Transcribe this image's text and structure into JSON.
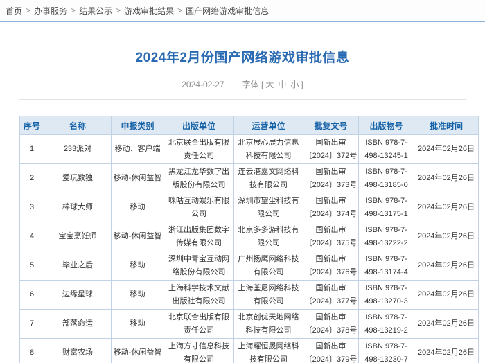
{
  "breadcrumb": {
    "separator": ">",
    "items": [
      "首页",
      "办事服务",
      "结果公示",
      "游戏审批结果",
      "国产网络游戏审批信息"
    ]
  },
  "article": {
    "title": "2024年2月份国产网络游戏审批信息",
    "date": "2024-02-27",
    "font_size_label": "字体",
    "bracket_open": "[",
    "bracket_close": "]",
    "font_size_options": [
      "大",
      "中",
      "小"
    ]
  },
  "table": {
    "columns": [
      "序号",
      "名称",
      "申报类别",
      "出版单位",
      "运营单位",
      "批复文号",
      "出版物号",
      "批准时间"
    ],
    "rows": [
      {
        "no": "1",
        "name": "233派对",
        "category": "移动、客户端",
        "publisher": "北京联合出版有限责任公司",
        "operator": "北京展心展力信息科技有限公司",
        "approval_no": "国新出审\n〔2024〕372号",
        "isbn": "ISBN 978-7-\n498-13245-1",
        "approval_date": "2024年02月26日"
      },
      {
        "no": "2",
        "name": "爱玩数独",
        "category": "移动-休闲益智",
        "publisher": "黑龙江龙华数字出版股份有限公司",
        "operator": "连云港嘉文网络科技有限公司",
        "approval_no": "国新出审\n〔2024〕373号",
        "isbn": "ISBN 978-7-\n498-13185-0",
        "approval_date": "2024年02月26日"
      },
      {
        "no": "3",
        "name": "棒球大师",
        "category": "移动",
        "publisher": "咪咕互动娱乐有限公司",
        "operator": "深圳市望尘科技有限公司",
        "approval_no": "国新出审\n〔2024〕374号",
        "isbn": "ISBN 978-7-\n498-13175-1",
        "approval_date": "2024年02月26日"
      },
      {
        "no": "4",
        "name": "宝宝烹饪师",
        "category": "移动-休闲益智",
        "publisher": "浙江出版集团数字传媒有限公司",
        "operator": "北京多多游科技有限公司",
        "approval_no": "国新出审\n〔2024〕375号",
        "isbn": "ISBN 978-7-\n498-13222-2",
        "approval_date": "2024年02月26日"
      },
      {
        "no": "5",
        "name": "毕业之后",
        "category": "移动",
        "publisher": "深圳中青宝互动网络股份有限公司",
        "operator": "广州扬鹰网络科技有限公司",
        "approval_no": "国新出审\n〔2024〕376号",
        "isbn": "ISBN 978-7-\n498-13174-4",
        "approval_date": "2024年02月26日"
      },
      {
        "no": "6",
        "name": "边缘星球",
        "category": "移动",
        "publisher": "上海科学技术文献出版社有限公司",
        "operator": "上海荃尼网络科技有限公司",
        "approval_no": "国新出审\n〔2024〕377号",
        "isbn": "ISBN 978-7-\n498-13270-3",
        "approval_date": "2024年02月26日"
      },
      {
        "no": "7",
        "name": "部落命运",
        "category": "移动",
        "publisher": "北京联合出版有限责任公司",
        "operator": "北京创优天地网络科技有限公司",
        "approval_no": "国新出审\n〔2024〕378号",
        "isbn": "ISBN 978-7-\n498-13219-2",
        "approval_date": "2024年02月26日"
      },
      {
        "no": "8",
        "name": "财富农场",
        "category": "移动-休闲益智",
        "publisher": "上海方寸信息科技有限公司",
        "operator": "上海耀恒晟网络科技有限公司",
        "approval_no": "国新出审\n〔2024〕379号",
        "isbn": "ISBN 978-7-\n498-13230-7",
        "approval_date": "2024年02月26日"
      }
    ]
  },
  "colors": {
    "title_blue": "#2a6ab2",
    "header_text_blue": "#1763a8",
    "header_bg": "#dfe9f4",
    "table_border": "#c0d2e4",
    "breadcrumb_line": "#90b2d9",
    "body_text": "#333333",
    "meta_grey": "#8c8c8c"
  }
}
